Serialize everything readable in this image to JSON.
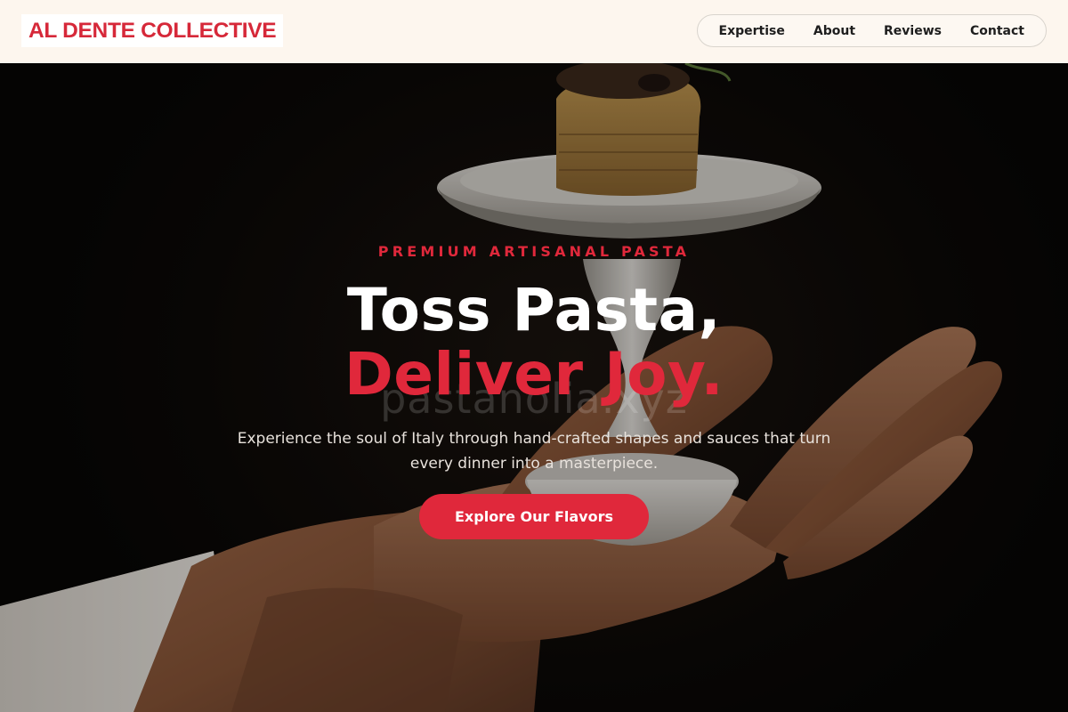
{
  "brand": {
    "name": "AL DENTE COLLECTIVE",
    "color": "#d62839"
  },
  "nav": {
    "items": [
      {
        "label": "Expertise"
      },
      {
        "label": "About"
      },
      {
        "label": "Reviews"
      },
      {
        "label": "Contact"
      }
    ]
  },
  "hero": {
    "eyebrow": "PREMIUM ARTISANAL PASTA",
    "headline_line1": "Toss Pasta,",
    "headline_line2": "Deliver Joy.",
    "subtitle": "Experience the soul of Italy through hand-crafted shapes and sauces that turn every dinner into a masterpiece.",
    "cta_label": "Explore Our Flavors",
    "watermark": "pastanolia.xyz",
    "background_image": "hand-holding-pasta-on-pedestal-plate",
    "accent_color": "#e0283b"
  }
}
